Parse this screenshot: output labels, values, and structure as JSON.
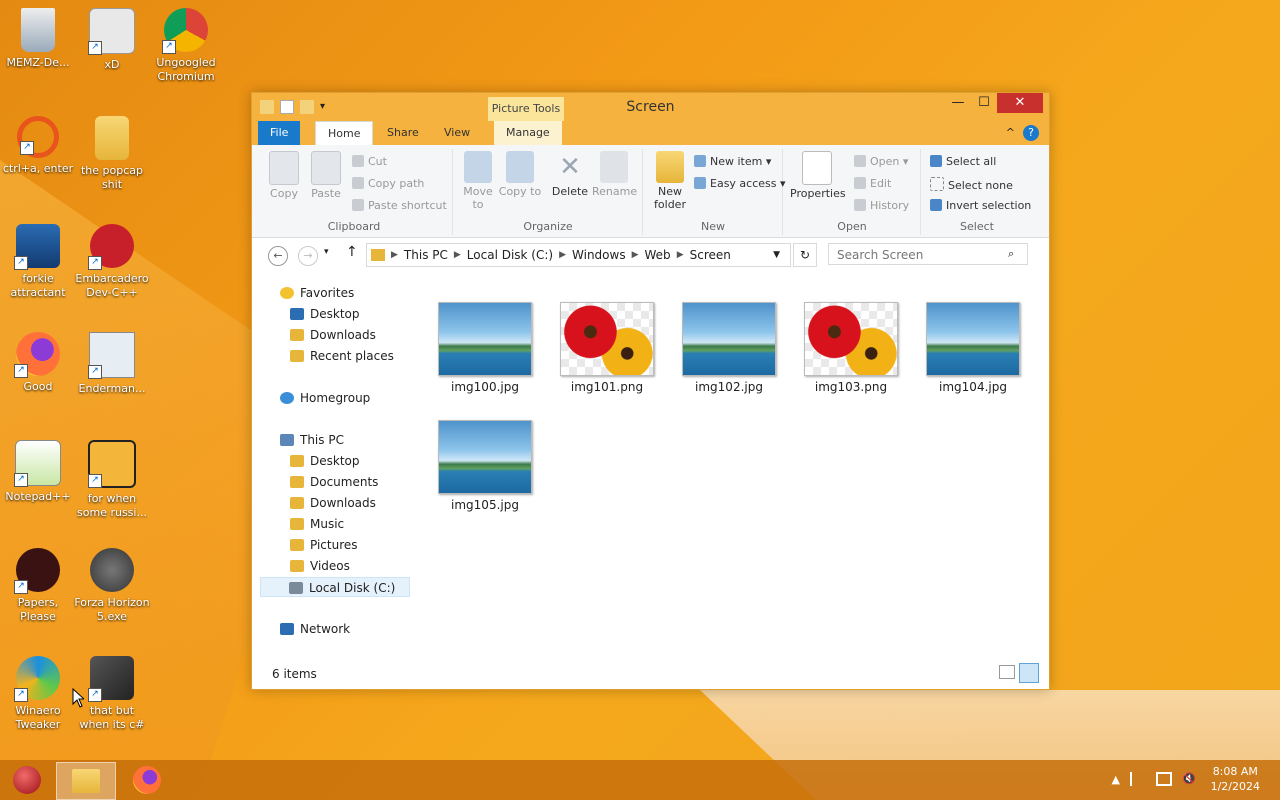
{
  "desktop": {
    "icons": [
      {
        "label": "MEMZ-De...",
        "icon": "recycle-bin-icon"
      },
      {
        "label": "xD",
        "icon": "hxd-icon"
      },
      {
        "label": "Ungoogled Chromium",
        "icon": "chromium-icon"
      },
      {
        "label": "ctrl+a, enter",
        "icon": "ring-icon"
      },
      {
        "label": "the popcap shit",
        "icon": "folder-icon"
      },
      {
        "label": "forkie attractant",
        "icon": "gear-monitor-icon"
      },
      {
        "label": "Embarcadero Dev-C++",
        "icon": "devcpp-icon"
      },
      {
        "label": "Good",
        "icon": "firefox-icon"
      },
      {
        "label": "Enderman...",
        "icon": "app-icon"
      },
      {
        "label": "Notepad++",
        "icon": "notepadpp-icon"
      },
      {
        "label": "for when some russi...",
        "icon": "de-icon"
      },
      {
        "label": "Papers, Please",
        "icon": "papers-icon"
      },
      {
        "label": "Forza Horizon 5.exe",
        "icon": "flash-icon"
      },
      {
        "label": "Winaero Tweaker",
        "icon": "winaero-icon"
      },
      {
        "label": "that but when its c#",
        "icon": "stack-icon"
      }
    ]
  },
  "window": {
    "title": "Screen",
    "contextual_tab": "Picture Tools",
    "controls": {
      "minimize": "—",
      "maximize": "☐",
      "close": "✕"
    },
    "tabs": {
      "file": "File",
      "home": "Home",
      "share": "Share",
      "view": "View",
      "manage": "Manage"
    },
    "ribbon": {
      "clipboard": {
        "label": "Clipboard",
        "copy": "Copy",
        "paste": "Paste",
        "cut": "Cut",
        "copy_path": "Copy path",
        "paste_shortcut": "Paste shortcut"
      },
      "organize": {
        "label": "Organize",
        "move_to": "Move to",
        "copy_to": "Copy to",
        "delete": "Delete",
        "rename": "Rename"
      },
      "new": {
        "label": "New",
        "new_folder": "New folder",
        "new_item": "New item ▾",
        "easy_access": "Easy access ▾"
      },
      "open": {
        "label": "Open",
        "properties": "Properties",
        "open": "Open ▾",
        "edit": "Edit",
        "history": "History"
      },
      "select": {
        "label": "Select",
        "select_all": "Select all",
        "select_none": "Select none",
        "invert_selection": "Invert selection"
      }
    },
    "address": {
      "path": [
        "This PC",
        "Local Disk (C:)",
        "Windows",
        "Web",
        "Screen"
      ],
      "search_placeholder": "Search Screen"
    },
    "nav": {
      "favorites": "Favorites",
      "fav_items": [
        "Desktop",
        "Downloads",
        "Recent places"
      ],
      "homegroup": "Homegroup",
      "thispc": "This PC",
      "pc_items": [
        "Desktop",
        "Documents",
        "Downloads",
        "Music",
        "Pictures",
        "Videos",
        "Local Disk (C:)"
      ],
      "network": "Network"
    },
    "files": [
      {
        "name": "img100.jpg",
        "kind": "sea"
      },
      {
        "name": "img101.png",
        "kind": "flower"
      },
      {
        "name": "img102.jpg",
        "kind": "sea"
      },
      {
        "name": "img103.png",
        "kind": "flower"
      },
      {
        "name": "img104.jpg",
        "kind": "sea"
      },
      {
        "name": "img105.jpg",
        "kind": "sea"
      }
    ],
    "status": "6 items"
  },
  "taskbar": {
    "time": "8:08 AM",
    "date": "1/2/2024"
  }
}
